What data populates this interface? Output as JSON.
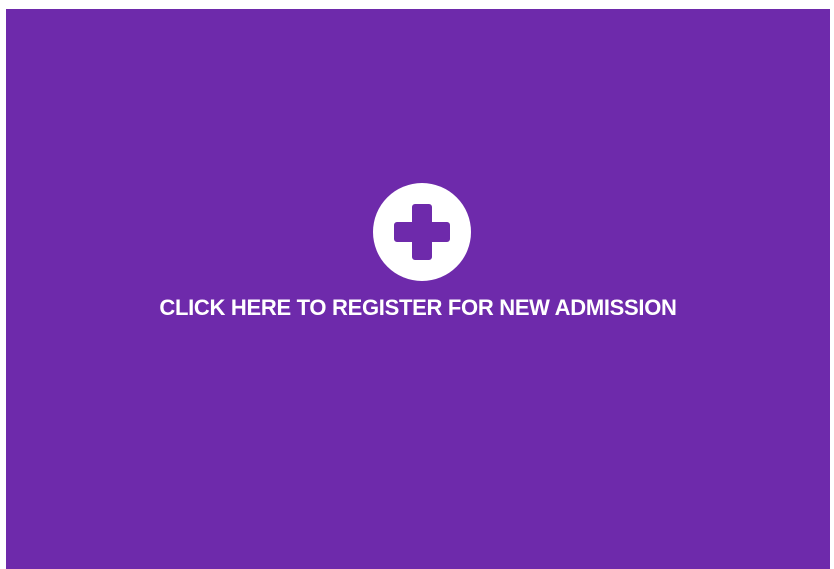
{
  "card": {
    "background": "#6e2aab",
    "text_color": "#ffffff",
    "icon": "plus-circle-icon",
    "label": "CLICK HERE TO REGISTER FOR NEW ADMISSION"
  }
}
